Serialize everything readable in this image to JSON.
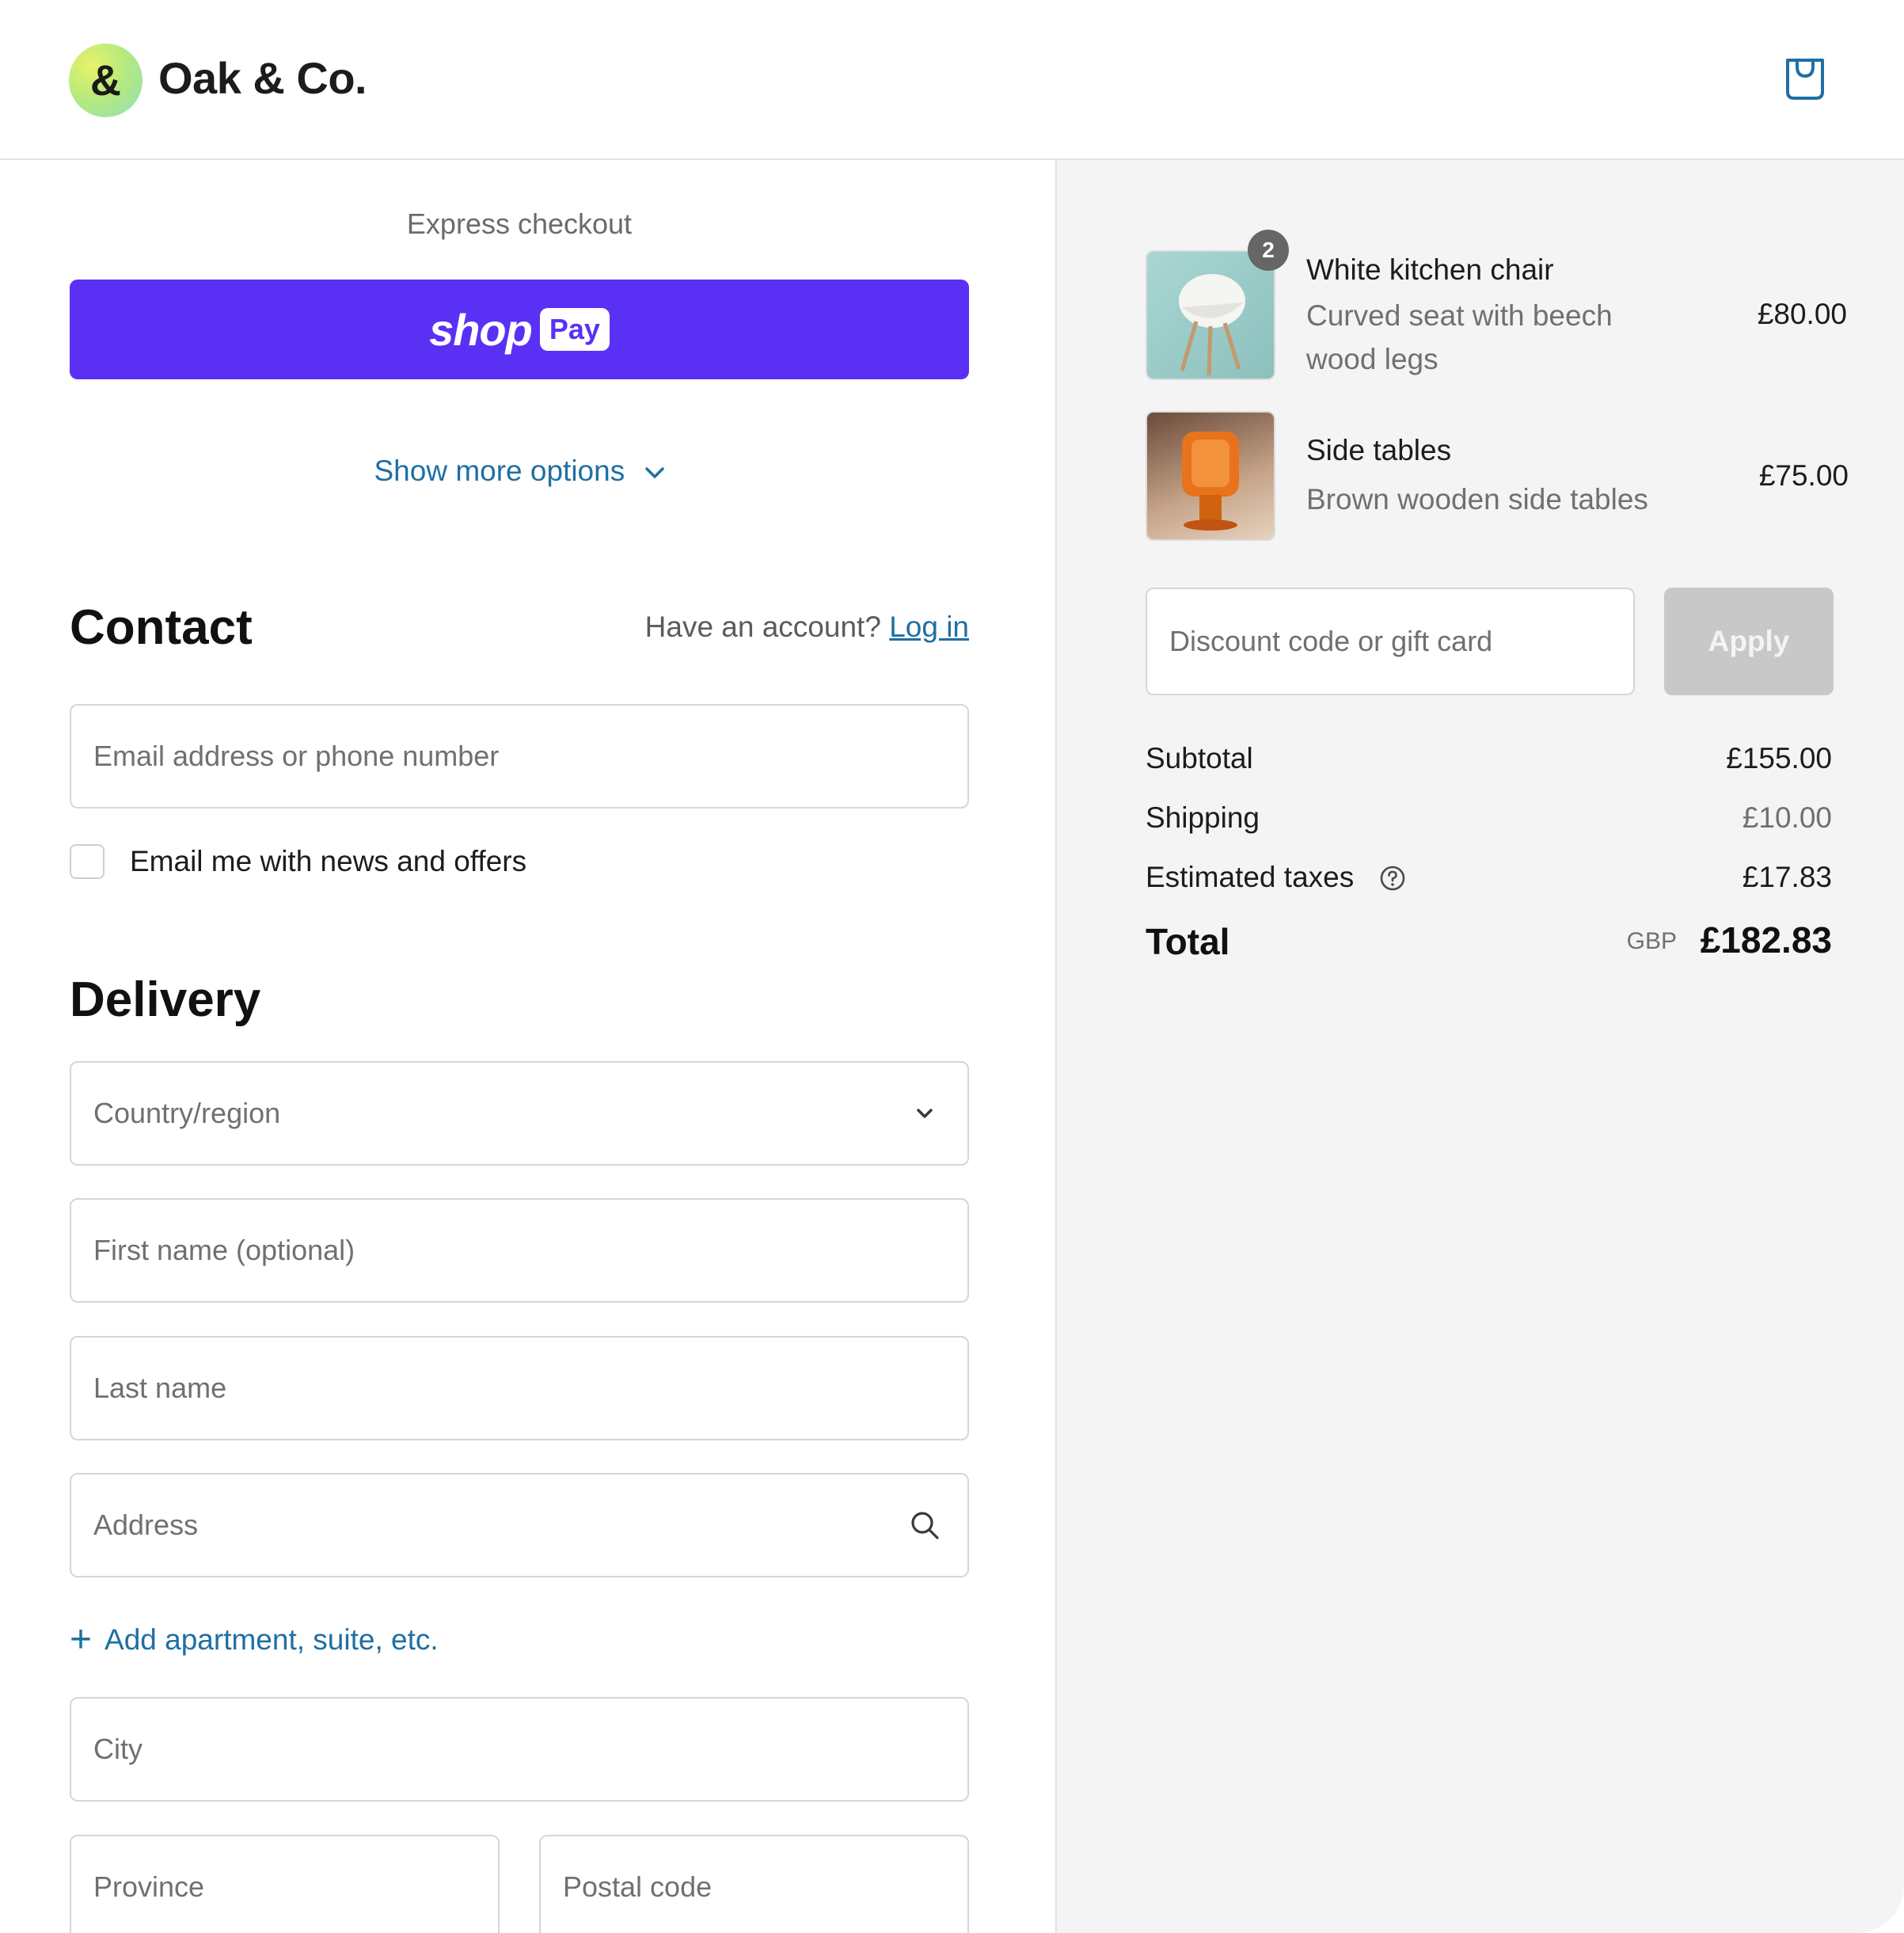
{
  "header": {
    "logo_glyph": "&",
    "brand": "Oak & Co.",
    "cart_icon": "shopping-bag-icon",
    "accent_color": "#1f6fa3"
  },
  "express": {
    "label": "Express checkout",
    "shop_word": "shop",
    "pay_badge": "Pay",
    "button_color": "#5a31f4",
    "more_options": "Show more options"
  },
  "contact": {
    "heading": "Contact",
    "account_prompt": "Have an account?",
    "login_link": "Log in",
    "email_placeholder": "Email address or phone number",
    "newsletter_label": "Email me with news and offers",
    "newsletter_checked": false
  },
  "delivery": {
    "heading": "Delivery",
    "country_placeholder": "Country/region",
    "first_name_placeholder": "First name (optional)",
    "last_name_placeholder": "Last name",
    "address_placeholder": "Address",
    "add_apartment": "Add apartment, suite, etc.",
    "city_placeholder": "City",
    "province_placeholder": "Province",
    "postal_placeholder": "Postal code"
  },
  "cart": {
    "items": [
      {
        "title": "White kitchen chair",
        "description": "Curved seat with beech wood legs",
        "price": "£80.00",
        "quantity": "2"
      },
      {
        "title": "Side tables",
        "description": "Brown wooden side tables",
        "price": "£75.00"
      }
    ],
    "discount_placeholder": "Discount code or gift card",
    "apply_label": "Apply"
  },
  "summary": {
    "subtotal_label": "Subtotal",
    "subtotal_value": "£155.00",
    "shipping_label": "Shipping",
    "shipping_value": "£10.00",
    "taxes_label": "Estimated taxes",
    "taxes_value": "£17.83",
    "total_label": "Total",
    "currency": "GBP",
    "total_value": "£182.83"
  }
}
